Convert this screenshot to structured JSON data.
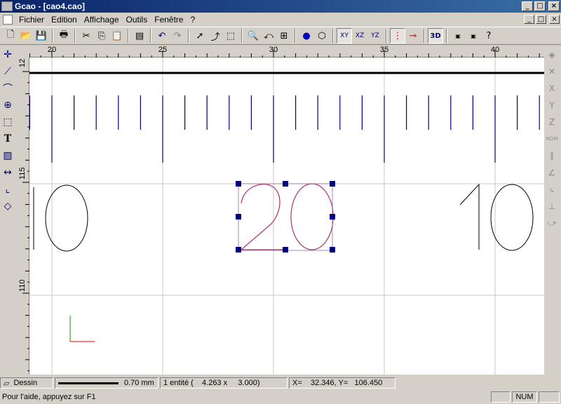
{
  "window": {
    "title": "Gcao - [cao4.cao]",
    "minimize": "_",
    "maximize": "□",
    "close": "×"
  },
  "menu": {
    "items": [
      "Fichier",
      "Edition",
      "Affichage",
      "Outils",
      "Fenêtre",
      "?"
    ]
  },
  "toolbar": {
    "buttons": [
      "new",
      "open",
      "save",
      "print",
      "cut",
      "copy",
      "paste",
      "properties",
      "undo",
      "redo",
      "select",
      "edit-points",
      "zoom-window",
      "zoom-extents",
      "zoom-previous",
      "zoom-all",
      "render",
      "box",
      "view-xy",
      "view-xz",
      "view-yz",
      "snap",
      "snap-point",
      "view-3d",
      "prn-2d",
      "prn-3d",
      "help-cursor"
    ],
    "view_3d_label": "3D"
  },
  "left_tools": [
    "point",
    "polyline",
    "arc",
    "circle",
    "rectangle",
    "text",
    "hatch",
    "dimension",
    "fillet",
    "eraser"
  ],
  "right_tools": [
    "orbit",
    "rotate",
    "axis-x",
    "axis-y",
    "axis-z",
    "normal",
    "parallel",
    "angle",
    "angle-2",
    "perpendicular",
    "tangent"
  ],
  "right_labels": {
    "x": "X",
    "y": "Y",
    "z": "Z",
    "nom": "NOM"
  },
  "ruler": {
    "h_labels": [
      "20",
      "25",
      "30",
      "35",
      "40"
    ],
    "v_labels": [
      "12",
      "115",
      "110"
    ]
  },
  "drawing": {
    "left_number": "10",
    "center_number": "20",
    "right_number": "10"
  },
  "status": {
    "layer": "Dessin",
    "line_width": "0.70 mm",
    "selection": "1 entité (    4.263 x     3.000)",
    "coords": "X=    32.346, Y=   106.450",
    "help": "Pour l'aide, appuyez sur F1",
    "num": "NUM"
  },
  "colors": {
    "title_start": "#0a246a",
    "title_end": "#3a6ea5",
    "grid": "#c8c8c8",
    "ticks": "#000080",
    "selection": "#b0306b",
    "handles": "#000080"
  }
}
